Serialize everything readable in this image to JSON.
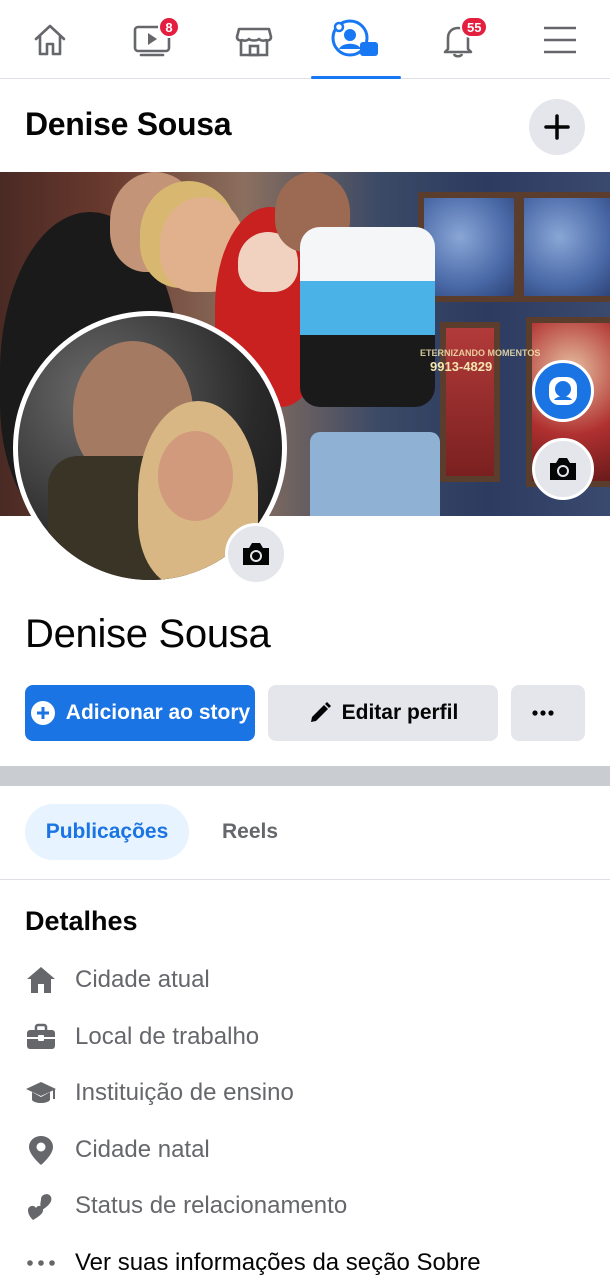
{
  "nav": {
    "items": [
      {
        "name": "home-icon"
      },
      {
        "name": "video-icon",
        "badge": "8"
      },
      {
        "name": "marketplace-icon"
      },
      {
        "name": "groups-icon",
        "active": true
      },
      {
        "name": "bell-icon",
        "badge": "55"
      },
      {
        "name": "menu-icon"
      }
    ],
    "accent": "#1877f2",
    "badge_color": "#e41e3f"
  },
  "header": {
    "title": "Denise Sousa",
    "add_icon": "plus-icon"
  },
  "cover": {
    "watermark_line1": "ETERNIZANDO MOMENTOS",
    "watermark_line2": "9913-4829"
  },
  "profile": {
    "name": "Denise Sousa"
  },
  "actions": {
    "add_story": "Adicionar ao story",
    "edit_profile": "Editar perfil",
    "more": "..."
  },
  "tabs": [
    {
      "label": "Publicações",
      "active": true
    },
    {
      "label": "Reels",
      "active": false
    }
  ],
  "details": {
    "title": "Detalhes",
    "items": [
      {
        "icon": "house-icon",
        "label": "Cidade atual"
      },
      {
        "icon": "briefcase-icon",
        "label": "Local de trabalho"
      },
      {
        "icon": "graduation-cap-icon",
        "label": "Instituição de ensino"
      },
      {
        "icon": "location-pin-icon",
        "label": "Cidade natal"
      },
      {
        "icon": "hearts-icon",
        "label": "Status de relacionamento"
      },
      {
        "icon": "ellipsis-icon",
        "label": "Ver suas informações da seção Sobre"
      }
    ]
  },
  "colors": {
    "primary": "#1b74e4",
    "secondary_bg": "#e4e6eb",
    "muted_text": "#65676b",
    "tab_active_bg": "#e7f3ff"
  }
}
